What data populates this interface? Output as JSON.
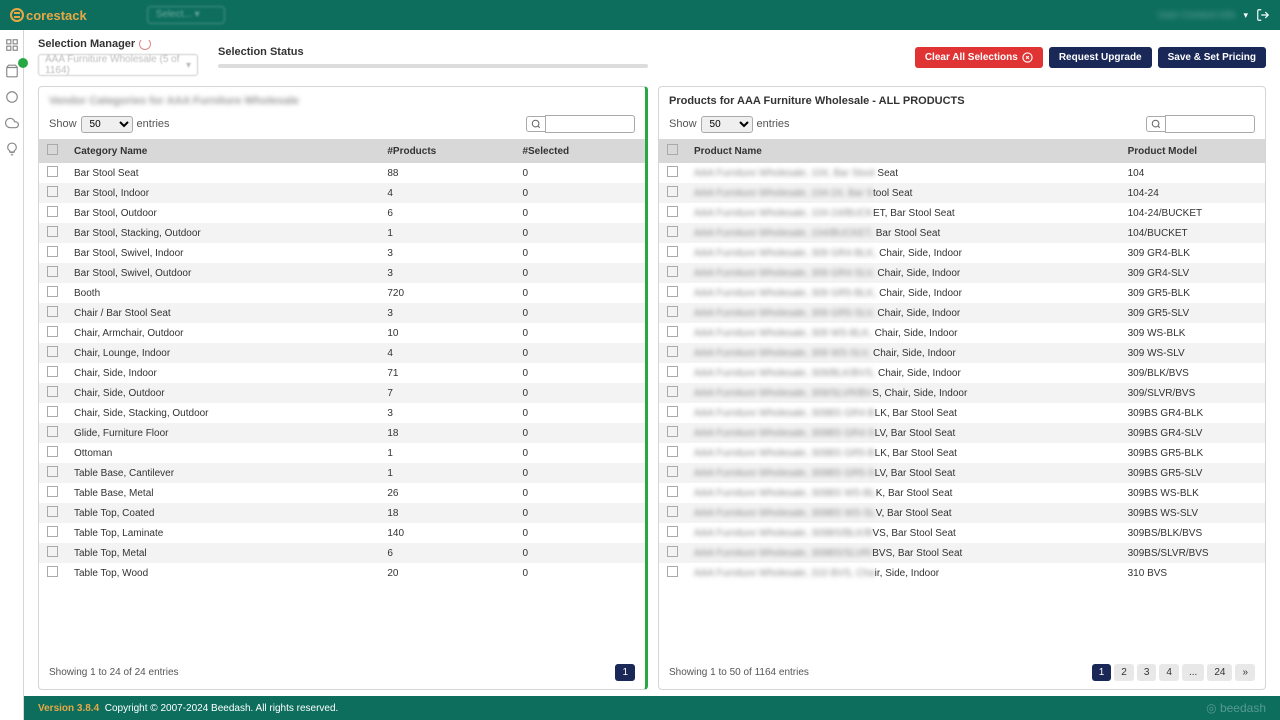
{
  "brand": "corestack",
  "topbar": {
    "dropdown_placeholder": "Select...",
    "user_blur": "User Context Info"
  },
  "selection_manager": {
    "label": "Selection Manager",
    "dropdown_text": "AAA Furniture Wholesale (5 of 1164)"
  },
  "status": {
    "label": "Selection Status",
    "percent": 0
  },
  "buttons": {
    "clear": "Clear All Selections",
    "upgrade": "Request Upgrade",
    "save": "Save & Set Pricing"
  },
  "left_panel": {
    "title": "Vendor Categories for AAA Furniture Wholesale",
    "show": "Show",
    "entries": "entries",
    "page_size": "50",
    "headers": {
      "name": "Category Name",
      "products": "#Products",
      "selected": "#Selected"
    },
    "rows": [
      {
        "name": "Bar Stool Seat",
        "products": "88",
        "selected": "0"
      },
      {
        "name": "Bar Stool, Indoor",
        "products": "4",
        "selected": "0"
      },
      {
        "name": "Bar Stool, Outdoor",
        "products": "6",
        "selected": "0"
      },
      {
        "name": "Bar Stool, Stacking, Outdoor",
        "products": "1",
        "selected": "0"
      },
      {
        "name": "Bar Stool, Swivel, Indoor",
        "products": "3",
        "selected": "0"
      },
      {
        "name": "Bar Stool, Swivel, Outdoor",
        "products": "3",
        "selected": "0"
      },
      {
        "name": "Booth",
        "products": "720",
        "selected": "0"
      },
      {
        "name": "Chair / Bar Stool Seat",
        "products": "3",
        "selected": "0"
      },
      {
        "name": "Chair, Armchair, Outdoor",
        "products": "10",
        "selected": "0"
      },
      {
        "name": "Chair, Lounge, Indoor",
        "products": "4",
        "selected": "0"
      },
      {
        "name": "Chair, Side, Indoor",
        "products": "71",
        "selected": "0"
      },
      {
        "name": "Chair, Side, Outdoor",
        "products": "7",
        "selected": "0"
      },
      {
        "name": "Chair, Side, Stacking, Outdoor",
        "products": "3",
        "selected": "0"
      },
      {
        "name": "Glide, Furniture Floor",
        "products": "18",
        "selected": "0"
      },
      {
        "name": "Ottoman",
        "products": "1",
        "selected": "0"
      },
      {
        "name": "Table Base, Cantilever",
        "products": "1",
        "selected": "0"
      },
      {
        "name": "Table Base, Metal",
        "products": "26",
        "selected": "0"
      },
      {
        "name": "Table Top, Coated",
        "products": "18",
        "selected": "0"
      },
      {
        "name": "Table Top, Laminate",
        "products": "140",
        "selected": "0"
      },
      {
        "name": "Table Top, Metal",
        "products": "6",
        "selected": "0"
      },
      {
        "name": "Table Top, Wood",
        "products": "20",
        "selected": "0"
      }
    ],
    "footer": "Showing 1 to 24 of 24 entries",
    "pages": [
      "1"
    ]
  },
  "right_panel": {
    "title": "Products for AAA Furniture Wholesale - ALL PRODUCTS",
    "show": "Show",
    "entries": "entries",
    "page_size": "50",
    "headers": {
      "name": "Product Name",
      "model": "Product Model"
    },
    "rows": [
      {
        "prefix": "AAA Furniture Wholesale, 104, Bar Stool",
        "suffix": " Seat",
        "model": "104"
      },
      {
        "prefix": "AAA Furniture Wholesale, 104-24, Bar S",
        "suffix": "tool Seat",
        "model": "104-24"
      },
      {
        "prefix": "AAA Furniture Wholesale, 104-24/BUCK",
        "suffix": "ET, Bar Stool Seat",
        "model": "104-24/BUCKET"
      },
      {
        "prefix": "AAA Furniture Wholesale, 104/BUCKET,",
        "suffix": " Bar Stool Seat",
        "model": "104/BUCKET"
      },
      {
        "prefix": "AAA Furniture Wholesale, 309 GR4-BLK,",
        "suffix": " Chair, Side, Indoor",
        "model": "309 GR4-BLK"
      },
      {
        "prefix": "AAA Furniture Wholesale, 309 GR4-SLV,",
        "suffix": " Chair, Side, Indoor",
        "model": "309 GR4-SLV"
      },
      {
        "prefix": "AAA Furniture Wholesale, 309 GR5-BLK,",
        "suffix": " Chair, Side, Indoor",
        "model": "309 GR5-BLK"
      },
      {
        "prefix": "AAA Furniture Wholesale, 309 GR5-SLV,",
        "suffix": " Chair, Side, Indoor",
        "model": "309 GR5-SLV"
      },
      {
        "prefix": "AAA Furniture Wholesale, 309 WS-BLK,",
        "suffix": " Chair, Side, Indoor",
        "model": "309 WS-BLK"
      },
      {
        "prefix": "AAA Furniture Wholesale, 309 WS-SLV,",
        "suffix": " Chair, Side, Indoor",
        "model": "309 WS-SLV"
      },
      {
        "prefix": "AAA Furniture Wholesale, 309/BLK/BVS,",
        "suffix": " Chair, Side, Indoor",
        "model": "309/BLK/BVS"
      },
      {
        "prefix": "AAA Furniture Wholesale, 309/SLVR/BV",
        "suffix": "S, Chair, Side, Indoor",
        "model": "309/SLVR/BVS"
      },
      {
        "prefix": "AAA Furniture Wholesale, 309BS GR4-B",
        "suffix": "LK, Bar Stool Seat",
        "model": "309BS GR4-BLK"
      },
      {
        "prefix": "AAA Furniture Wholesale, 309BS GR4-S",
        "suffix": "LV, Bar Stool Seat",
        "model": "309BS GR4-SLV"
      },
      {
        "prefix": "AAA Furniture Wholesale, 309BS GR5-B",
        "suffix": "LK, Bar Stool Seat",
        "model": "309BS GR5-BLK"
      },
      {
        "prefix": "AAA Furniture Wholesale, 309BS GR5-S",
        "suffix": "LV, Bar Stool Seat",
        "model": "309BS GR5-SLV"
      },
      {
        "prefix": "AAA Furniture Wholesale, 309BS WS-BL",
        "suffix": "K, Bar Stool Seat",
        "model": "309BS WS-BLK"
      },
      {
        "prefix": "AAA Furniture Wholesale, 309BS WS-SL",
        "suffix": "V, Bar Stool Seat",
        "model": "309BS WS-SLV"
      },
      {
        "prefix": "AAA Furniture Wholesale, 309BS/BLK/B",
        "suffix": "VS, Bar Stool Seat",
        "model": "309BS/BLK/BVS"
      },
      {
        "prefix": "AAA Furniture Wholesale, 309BS/SLVR/",
        "suffix": "BVS, Bar Stool Seat",
        "model": "309BS/SLVR/BVS"
      },
      {
        "prefix": "AAA Furniture Wholesale, 310 BVS, Cha",
        "suffix": "ir, Side, Indoor",
        "model": "310 BVS"
      }
    ],
    "footer": "Showing 1 to 50 of 1164 entries",
    "pages": [
      "1",
      "2",
      "3",
      "4",
      "...",
      "24",
      "»"
    ]
  },
  "footer": {
    "version": "Version 3.8.4",
    "copyright": "Copyright © 2007-2024 Beedash. All rights reserved.",
    "beedash": "beedash"
  }
}
